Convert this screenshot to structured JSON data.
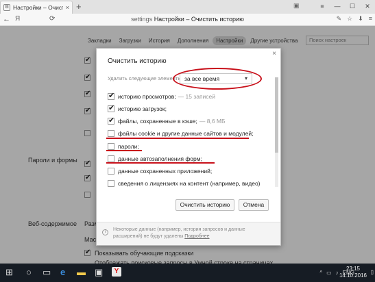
{
  "browser": {
    "tab_title": "Настройки – Очистить ис",
    "tab_close": "×",
    "new_tab": "+",
    "window_buttons": {
      "menu": "≡",
      "minimize": "—",
      "maximize": "☐",
      "close": "✕"
    },
    "back": "←",
    "logo": "Я",
    "reload": "⟳",
    "url_host": "settings",
    "url_path": "Настройки – Очистить историю",
    "addr_icons": [
      "✎",
      "☆",
      "⬇",
      "≡"
    ]
  },
  "settings": {
    "nav_tabs": [
      "Закладки",
      "Загрузки",
      "История",
      "Дополнения",
      "Настройки",
      "Другие устройства"
    ],
    "active_tab": "Настройки",
    "search_placeholder": "Поиск настроек",
    "sections": {
      "passwords": "Пароли и формы",
      "web_content": "Веб-содержимое"
    },
    "bg_fragments": {
      "size_prefix": "Разм",
      "scale_prefix": "Масш",
      "hints": "Показывать обучающие подсказки",
      "truncated": "Отображать поисковые запросы в Умной строке на страницах"
    }
  },
  "dialog": {
    "title": "Очистить историю",
    "close": "×",
    "delete_label": "Удалить следующие элементы:",
    "period": "за все время",
    "items": [
      {
        "label": "историю просмотров;",
        "checked": true,
        "extra": "— 15 записей"
      },
      {
        "label": "историю загрузок;",
        "checked": true,
        "extra": ""
      },
      {
        "label": "файлы, сохраненные в кэше;",
        "checked": true,
        "extra": "— 8,6 МБ"
      },
      {
        "label": "файлы cookie и другие данные сайтов и модулей;",
        "checked": false,
        "extra": ""
      },
      {
        "label": "пароли;",
        "checked": false,
        "extra": ""
      },
      {
        "label": "данные автозаполнения форм;",
        "checked": false,
        "extra": ""
      },
      {
        "label": "данные сохраненных приложений;",
        "checked": false,
        "extra": ""
      },
      {
        "label": "сведения о лицензиях на контент (например, видео)",
        "checked": false,
        "extra": ""
      }
    ],
    "clear_button": "Очистить историю",
    "cancel_button": "Отмена",
    "note": "Некоторые данные (например, история запросов и данные расширений) не будут удалены",
    "note_link": "Подробнее",
    "annotation_color": "#c8101a"
  },
  "taskbar": {
    "start": "⊞",
    "search": "○",
    "taskview": "▭",
    "edge": "e",
    "explorer": "▬",
    "store": "▣",
    "yandex": "Y",
    "tray_icons": [
      "^",
      "▭",
      "♪",
      "ENG"
    ],
    "time": "23:15",
    "date": "14.10.2016",
    "notifications": "▯"
  }
}
